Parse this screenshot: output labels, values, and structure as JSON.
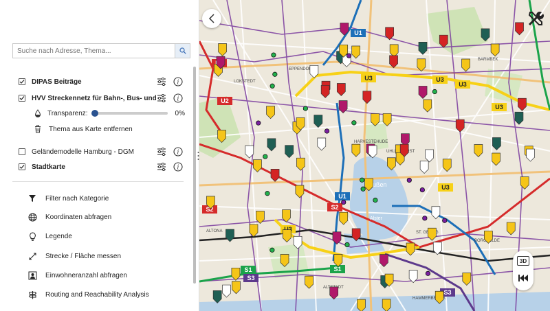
{
  "search": {
    "placeholder": "Suche nach Adresse, Thema..."
  },
  "layers": [
    {
      "label": "DIPAS Beiträge",
      "checked": true,
      "bold": true
    },
    {
      "label": "HVV Streckennetz für Bahn-, Bus- und ...",
      "checked": true,
      "bold": true
    },
    {
      "label": "Geländemodelle Hamburg - DGM",
      "checked": false,
      "bold": false
    },
    {
      "label": "Stadtkarte",
      "checked": true,
      "bold": true
    }
  ],
  "transparency": {
    "label": "Transparenz:",
    "value": "0%"
  },
  "remove_theme": {
    "label": "Thema aus Karte entfernen"
  },
  "tools": [
    {
      "label": "Filter nach Kategorie",
      "icon": "filter-icon"
    },
    {
      "label": "Koordinaten abfragen",
      "icon": "globe-icon"
    },
    {
      "label": "Legende",
      "icon": "lightbulb-icon"
    },
    {
      "label": "Strecke / Fläche messen",
      "icon": "measure-icon"
    },
    {
      "label": "Einwohneranzahl abfragen",
      "icon": "population-icon"
    },
    {
      "label": "Routing and Reachability Analysis",
      "icon": "signpost-icon"
    }
  ],
  "map": {
    "ctrl_3d": "3D",
    "lines": [
      {
        "label": "U3",
        "color": "#f7d117"
      },
      {
        "label": "U1",
        "color": "#1c6fb8"
      },
      {
        "label": "U2",
        "color": "#d52b2b"
      },
      {
        "label": "S1",
        "color": "#1aa34a"
      },
      {
        "label": "S2",
        "color": "#d52b2b"
      },
      {
        "label": "S3",
        "color": "#5d3a8c"
      }
    ],
    "districts": [
      "EPPENDORF",
      "BARMBEK",
      "ALTONA",
      "ALTSTADT",
      "HAMMERBROOK",
      "BORGFELDE",
      "ST. GEORG",
      "UHLENHORST",
      "HARVESTEHUDE",
      "LOKSTEDT",
      "Außen",
      "Alster"
    ]
  },
  "colors": {
    "accent": "#2a5290",
    "marker_yellow": "#f5c518",
    "marker_red": "#d42424",
    "marker_teal": "#1f5f54",
    "marker_magenta": "#b0186a",
    "water": "#b7d1e8"
  }
}
